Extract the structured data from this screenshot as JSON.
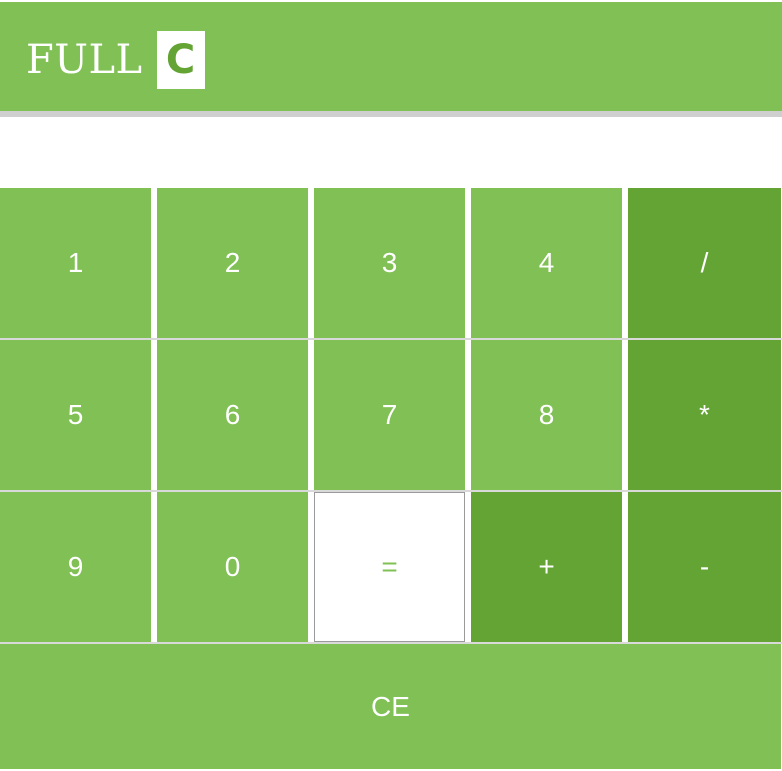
{
  "brand": {
    "text": "FULL",
    "badge": "C"
  },
  "display": {
    "value": ""
  },
  "keys": {
    "k1": "1",
    "k2": "2",
    "k3": "3",
    "k4": "4",
    "div": "/",
    "k5": "5",
    "k6": "6",
    "k7": "7",
    "k8": "8",
    "mul": "*",
    "k9": "9",
    "k0": "0",
    "eq": "=",
    "add": "+",
    "sub": "-",
    "ce": "CE"
  },
  "colors": {
    "primary": "#80c054",
    "operator": "#63a434",
    "equals_bg": "#ffffff",
    "divider": "#cfcfcf"
  }
}
